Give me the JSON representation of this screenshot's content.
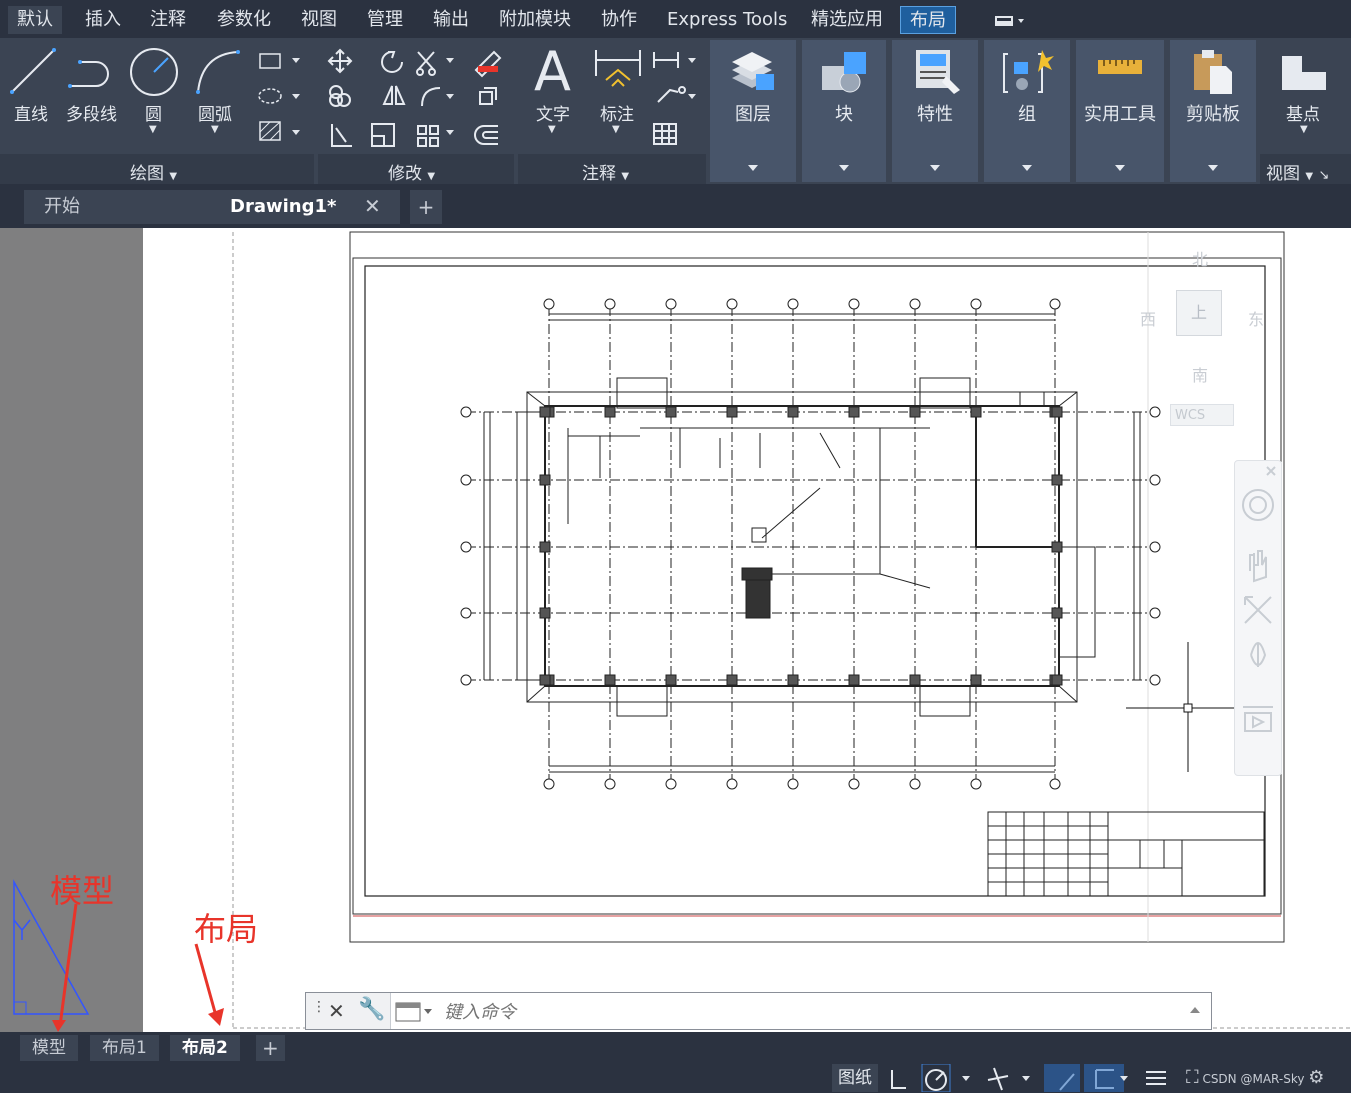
{
  "menu": {
    "tabs": [
      "默认",
      "插入",
      "注释",
      "参数化",
      "视图",
      "管理",
      "输出",
      "附加模块",
      "协作",
      "Express Tools",
      "精选应用",
      "布局"
    ],
    "selected": "默认",
    "highlighted": "布局"
  },
  "ribbon": {
    "draw_panel": {
      "title": "绘图",
      "tools": {
        "line": "直线",
        "polyline": "多段线",
        "circle": "圆",
        "arc": "圆弧"
      }
    },
    "modify_panel": {
      "title": "修改"
    },
    "annotation_panel": {
      "title": "注释",
      "tools": {
        "text": "文字",
        "dimension": "标注"
      }
    },
    "big_panels": {
      "layers": "图层",
      "block": "块",
      "properties": "特性",
      "group": "组",
      "utilities": "实用工具",
      "clipboard": "剪贴板"
    },
    "view_panel": {
      "title": "视图",
      "basepoint": "基点"
    }
  },
  "doc_tabs": {
    "start": "开始",
    "drawing": "Drawing1*",
    "add": "+"
  },
  "viewcube": {
    "north": "北",
    "south": "南",
    "east": "东",
    "west": "西",
    "top": "上",
    "wcs": "WCS"
  },
  "command": {
    "placeholder": "键入命令"
  },
  "layout_tabs": {
    "model": "模型",
    "layout1": "布局1",
    "layout2": "布局2",
    "add": "+",
    "selected": "布局2"
  },
  "status": {
    "paper": "图纸",
    "watermark": "CSDN @MAR-Sky"
  },
  "annotations": {
    "model_label": "模型",
    "layout_label": "布局",
    "color": "#e8342a"
  },
  "colors": {
    "accent": "#1f5f9e",
    "ribbon_bg": "#3b4453",
    "dark_bg": "#2b3240"
  }
}
